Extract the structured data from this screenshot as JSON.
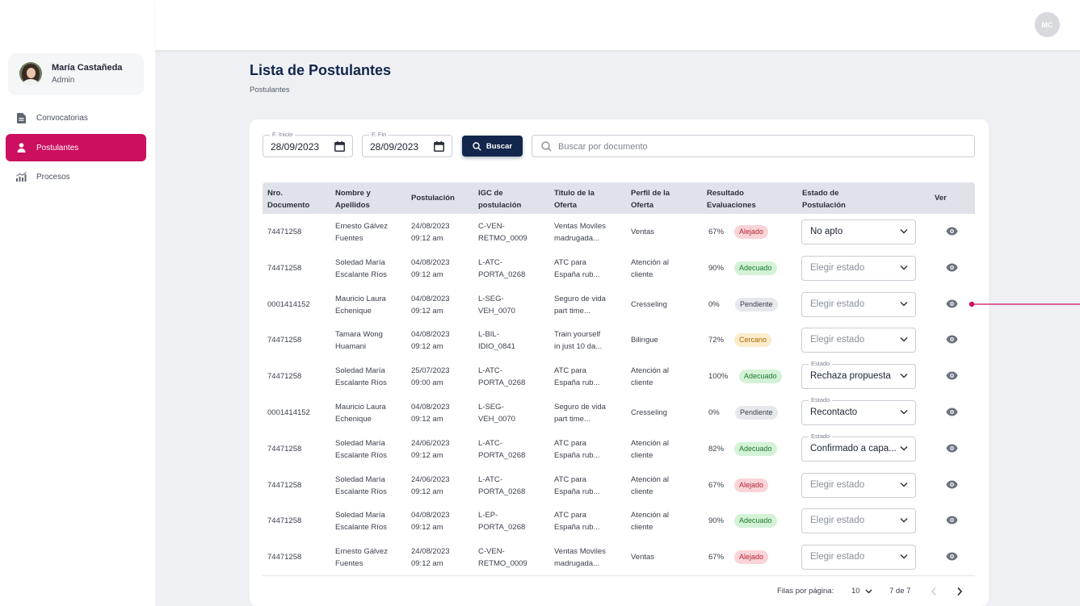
{
  "user": {
    "name": "María Castañeda",
    "role": "Admin",
    "initials": "MC"
  },
  "sidebar": {
    "items": [
      {
        "label": "Convocatorias",
        "icon": "document-icon",
        "active": false
      },
      {
        "label": "Postulantes",
        "icon": "user-icon",
        "active": true
      },
      {
        "label": "Procesos",
        "icon": "chart-icon",
        "active": false
      }
    ]
  },
  "page": {
    "title": "Lista de Postulantes",
    "breadcrumb": "Postulantes"
  },
  "filters": {
    "start_label": "F. Inicio",
    "start_value": "28/09/2023",
    "end_label": "F. Fin",
    "end_value": "28/09/2023",
    "search_button": "Buscar",
    "search_placeholder": "Buscar por documento"
  },
  "table": {
    "headers": {
      "doc": [
        "Nro.",
        "Documento"
      ],
      "name": [
        "Nombre y",
        "Apellidos"
      ],
      "postulacion": "Postulación",
      "igc": [
        "IGC de",
        "postulación"
      ],
      "titulo": [
        "Titulo de la",
        "Oferta"
      ],
      "perfil": [
        "Perfil de la",
        "Oferta"
      ],
      "resultado": [
        "Resultado",
        "Evaluaciones"
      ],
      "estado": [
        "Estado de",
        "Postulación"
      ],
      "ver": "Ver"
    },
    "status_float_label": "Estado",
    "rows": [
      {
        "doc": "74471258",
        "name1": "Ernesto Gálvez",
        "name2": "Fuentes",
        "date1": "24/08/2023",
        "date2": "09:12 am",
        "igc1": "C-VEN-",
        "igc2": "RETMO_0009",
        "title1": "Ventas Moviles",
        "title2": "madrugada...",
        "perfil1": "Ventas",
        "perfil2": "",
        "pct": "67%",
        "badge": "Alejado",
        "status": "No apto",
        "status_set": true,
        "status_floating": false
      },
      {
        "doc": "74471258",
        "name1": "Soledad María",
        "name2": "Escalante Ríos",
        "date1": "04/08/2023",
        "date2": "09:12 am",
        "igc1": "L-ATC-",
        "igc2": "PORTA_0268",
        "title1": "ATC para",
        "title2": "España rub...",
        "perfil1": "Atención al",
        "perfil2": "cliente",
        "pct": "90%",
        "badge": "Adecuado",
        "status": "Elegir estado",
        "status_set": false,
        "status_floating": false
      },
      {
        "doc": "0001414152",
        "name1": "Mauricio Laura",
        "name2": "Echenique",
        "date1": "04/08/2023",
        "date2": "09:12 am",
        "igc1": "L-SEG-",
        "igc2": "VEH_0070",
        "title1": "Seguro de vida",
        "title2": "part time...",
        "perfil1": "Cresseling",
        "perfil2": "",
        "pct": "0%",
        "badge": "Pendiente",
        "status": "Elegir estado",
        "status_set": false,
        "status_floating": false
      },
      {
        "doc": "74471258",
        "name1": "Tamara  Wong",
        "name2": "Huamani",
        "date1": "04/08/2023",
        "date2": "09:12 am",
        "igc1": "L-BIL-",
        "igc2": "IDIO_0841",
        "title1": "Train yourself",
        "title2": "in just 10 da...",
        "perfil1": "Bilingue",
        "perfil2": "",
        "pct": "72%",
        "badge": "Cercano",
        "status": "Elegir estado",
        "status_set": false,
        "status_floating": false
      },
      {
        "doc": "74471258",
        "name1": "Soledad María",
        "name2": "Escalante Ríos",
        "date1": "25/07/2023",
        "date2": "09:00 am",
        "igc1": "L-ATC-",
        "igc2": "PORTA_0268",
        "title1": "ATC para",
        "title2": "España rub...",
        "perfil1": "Atención al",
        "perfil2": "cliente",
        "pct": "100%",
        "badge": "Adecuado",
        "status": "Rechaza propuesta",
        "status_set": true,
        "status_floating": true
      },
      {
        "doc": "0001414152",
        "name1": "Mauricio Laura",
        "name2": "Echenique",
        "date1": "04/08/2023",
        "date2": "09:12 am",
        "igc1": "L-SEG-",
        "igc2": "VEH_0070",
        "title1": "Seguro de vida",
        "title2": "part time...",
        "perfil1": "Cresseling",
        "perfil2": "",
        "pct": "0%",
        "badge": "Pendiente",
        "status": "Recontacto",
        "status_set": true,
        "status_floating": true
      },
      {
        "doc": "74471258",
        "name1": "Soledad María",
        "name2": "Escalante Ríos",
        "date1": "24/06/2023",
        "date2": "09:12 am",
        "igc1": "L-ATC-",
        "igc2": "PORTA_0268",
        "title1": "ATC para",
        "title2": "España rub...",
        "perfil1": "Atención al",
        "perfil2": "cliente",
        "pct": "82%",
        "badge": "Adecuado",
        "status": "Confirmado a capa...",
        "status_set": true,
        "status_floating": true
      },
      {
        "doc": "74471258",
        "name1": "Soledad María",
        "name2": "Escalante Ríos",
        "date1": "24/06/2023",
        "date2": "09:12 am",
        "igc1": "L-ATC-",
        "igc2": "PORTA_0268",
        "title1": "ATC para",
        "title2": "España rub...",
        "perfil1": "Atención al",
        "perfil2": "cliente",
        "pct": "67%",
        "badge": "Alejado",
        "status": "Elegir estado",
        "status_set": false,
        "status_floating": false
      },
      {
        "doc": "74471258",
        "name1": "Soledad María",
        "name2": "Escalante Ríos",
        "date1": "04/08/2023",
        "date2": "09:12 am",
        "igc1": "L-EP-",
        "igc2": "PORTA_0268",
        "title1": "ATC para",
        "title2": "España rub...",
        "perfil1": "Atención al",
        "perfil2": "cliente",
        "pct": "90%",
        "badge": "Adecuado",
        "status": "Elegir estado",
        "status_set": false,
        "status_floating": false
      },
      {
        "doc": "74471258",
        "name1": "Ernesto Gálvez",
        "name2": "Fuentes",
        "date1": "24/08/2023",
        "date2": "09:12 am",
        "igc1": "C-VEN-",
        "igc2": "RETMO_0009",
        "title1": "Ventas Moviles",
        "title2": "madrugada...",
        "perfil1": "Ventas",
        "perfil2": "",
        "pct": "67%",
        "badge": "Alejado",
        "status": "Elegir estado",
        "status_set": false,
        "status_floating": false
      }
    ]
  },
  "badge_colors": {
    "Alejado": {
      "bg": "#f9d4d8",
      "fg": "#b3263a"
    },
    "Adecuado": {
      "bg": "#d3f2d6",
      "fg": "#1e7b33"
    },
    "Pendiente": {
      "bg": "#e6e8ec",
      "fg": "#3a3f4a"
    },
    "Cercano": {
      "bg": "#fdeccc",
      "fg": "#a66a00"
    }
  },
  "pagination": {
    "rows_label": "Filas por página:",
    "rows_value": "10",
    "count": "7 de 7"
  },
  "colors": {
    "accent": "#cc0f5e",
    "navy": "#13264b"
  }
}
